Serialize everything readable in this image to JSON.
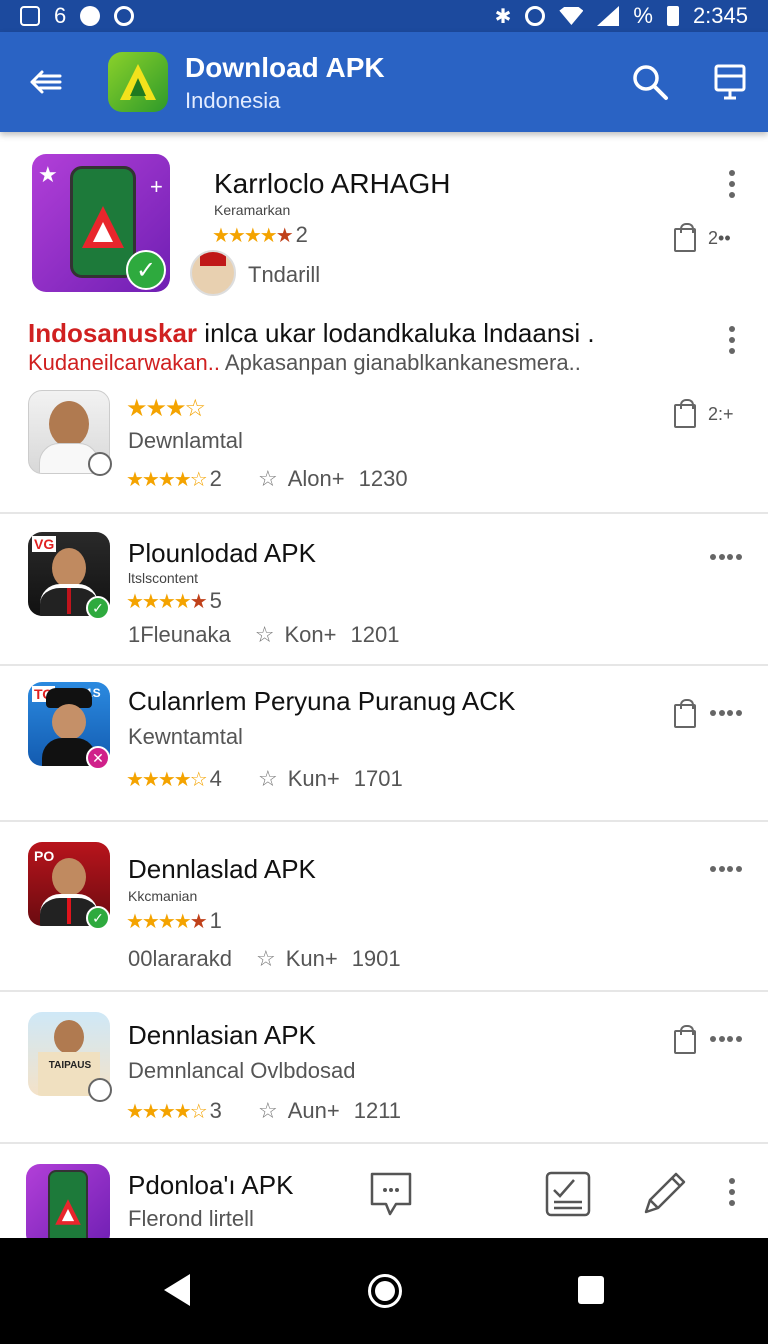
{
  "status_bar": {
    "left_text": "6",
    "time": "2:345",
    "percent_glyph": "%"
  },
  "app_bar": {
    "title": "Download APK",
    "subtitle": "Indonesia"
  },
  "featured": {
    "name": "Karrloclo ARHAGH",
    "category": "Keramarkan",
    "rating_number": "2",
    "uploader": "Tndarill",
    "extra": "2••"
  },
  "promo": {
    "title_red": "Indosanuskar",
    "title_rest": " inlca ukar lodandkaluka lndaansi .",
    "sub_red": "Kudaneilcarwakan..",
    "sub_rest": " Apkasanpan gianablkankanesmera.."
  },
  "items": [
    {
      "stars_top": "★★★☆",
      "sub": "Dewnlamtal",
      "rating_number": "2",
      "meta_label": "Alon+",
      "meta_value": "1230",
      "extra": "2:+"
    },
    {
      "name": "Plounlodad APK",
      "small": "ltslscontent",
      "rating_number": "5",
      "meta_prefix": "1Fleunaka",
      "meta_label": "Kon+",
      "meta_value": "1201",
      "tag": "VG"
    },
    {
      "name": "Culanrlem Peryuna Puranug ACK",
      "sub": "Kewntamtal",
      "rating_number": "4",
      "meta_label": "Kun+",
      "meta_value": "1701",
      "tag": "TO",
      "tag2": "1S"
    },
    {
      "name": "Dennlaslad APK",
      "small": "Kkcmanian",
      "rating_number": "1",
      "meta_prefix": "00lararakd",
      "meta_label": "Kun+",
      "meta_value": "1901",
      "tag": "PO"
    },
    {
      "name": "Dennlasian APK",
      "sub": "Demnlancal Ovlbdosad",
      "rating_number": "3",
      "meta_label": "Aun+",
      "meta_value": "1211",
      "icon_text": "TAIPAUS"
    },
    {
      "name": "Pdonloa'ı APK",
      "sub": "Flerond lirtell"
    }
  ],
  "colors": {
    "app_bar": "#2a63c4",
    "status_bar": "#1c4a9e",
    "star": "#f4a300",
    "check": "#2eaa3e",
    "red_text": "#d02020"
  }
}
